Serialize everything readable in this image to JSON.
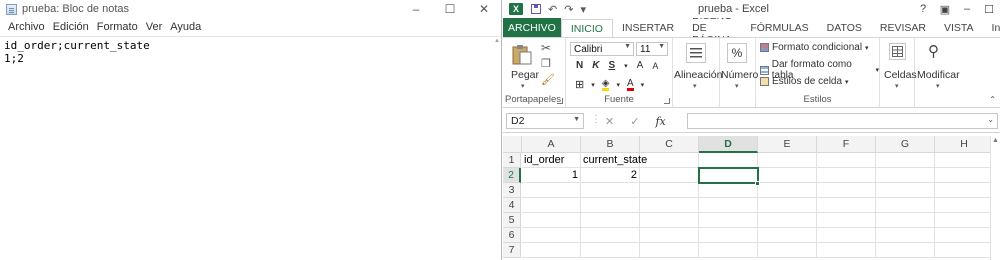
{
  "notepad": {
    "title": "prueba: Bloc de notas",
    "window_buttons": [
      "–",
      "☐",
      "✕"
    ],
    "menu": [
      "Archivo",
      "Edición",
      "Formato",
      "Ver",
      "Ayuda"
    ],
    "content_lines": [
      "id_order;current_state",
      "1;2"
    ]
  },
  "excel": {
    "logo": "X",
    "qat": [
      "↶",
      "↷"
    ],
    "title": "prueba - Excel",
    "title_right": [
      "?",
      "▣",
      "–",
      "☐"
    ],
    "tabs": [
      "ARCHIVO",
      "INICIO",
      "INSERTAR",
      "DISEÑO DE PÁGINA",
      "FÓRMULAS",
      "DATOS",
      "REVISAR",
      "VISTA",
      "Inicia"
    ],
    "active_tab_index": 1,
    "ribbon": {
      "clipboard": {
        "paste": "Pegar",
        "label": "Portapapeles"
      },
      "font": {
        "font_name": "Calibri",
        "font_size": "11",
        "bold": "N",
        "italic": "K",
        "underline": "S",
        "grow": "A",
        "shrink": "A",
        "font_color": "A",
        "label": "Fuente"
      },
      "alignment": {
        "label": "Alineación"
      },
      "number": {
        "symbol": "%",
        "label": "Número"
      },
      "styles": {
        "items": [
          "Formato condicional",
          "Dar formato como tabla",
          "Estilos de celda"
        ],
        "label": "Estilos"
      },
      "cells": {
        "label": "Celdas"
      },
      "editing": {
        "label": "Modificar"
      }
    },
    "formula_bar": {
      "name_box": "D2",
      "fx": "fx",
      "formula": ""
    },
    "columns": [
      "A",
      "B",
      "C",
      "D",
      "E",
      "F",
      "G",
      "H"
    ],
    "selected_column": "D",
    "rows": [
      "1",
      "2",
      "3",
      "4",
      "5",
      "6",
      "7"
    ],
    "selected_row": "2",
    "cells": {
      "A1": "id_order",
      "B1": "current_state",
      "A2": "1",
      "B2": "2"
    },
    "accent": "#217346"
  }
}
